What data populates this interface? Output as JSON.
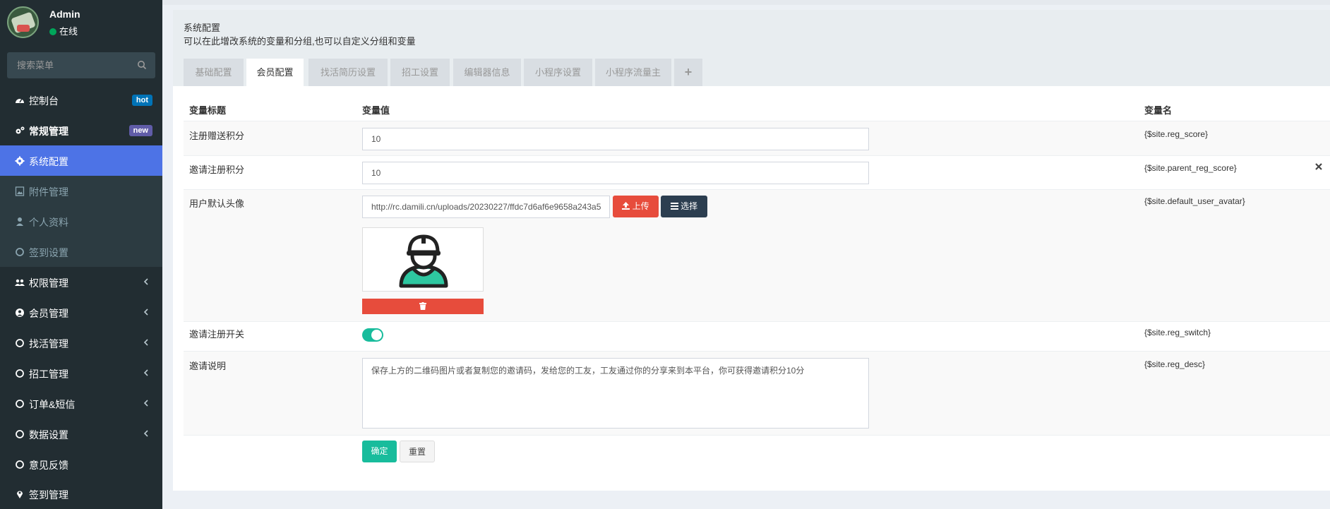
{
  "user": {
    "name": "Admin",
    "status": "在线"
  },
  "search": {
    "placeholder": "搜索菜单"
  },
  "sidebar": {
    "items": [
      {
        "label": "控制台",
        "badge": "hot",
        "badge_color": "#0073b7"
      },
      {
        "label": "常规管理",
        "badge": "new",
        "badge_color": "#605ca8"
      },
      {
        "label": "系统配置"
      },
      {
        "label": "附件管理"
      },
      {
        "label": "个人资料"
      },
      {
        "label": "签到设置"
      },
      {
        "label": "权限管理"
      },
      {
        "label": "会员管理"
      },
      {
        "label": "找活管理"
      },
      {
        "label": "招工管理"
      },
      {
        "label": "订单&短信"
      },
      {
        "label": "数据设置"
      },
      {
        "label": "意见反馈"
      },
      {
        "label": "签到管理"
      }
    ]
  },
  "page": {
    "title": "系统配置",
    "description": "可以在此增改系统的变量和分组,也可以自定义分组和变量"
  },
  "tabs": [
    {
      "label": "基础配置"
    },
    {
      "label": "会员配置"
    },
    {
      "label": "找活简历设置"
    },
    {
      "label": "招工设置"
    },
    {
      "label": "编辑器信息"
    },
    {
      "label": "小程序设置"
    },
    {
      "label": "小程序流量主"
    },
    {
      "label": "+"
    }
  ],
  "table": {
    "headers": {
      "title": "变量标题",
      "value": "变量值",
      "name": "变量名"
    },
    "rows": [
      {
        "title": "注册赠送积分",
        "value": "10",
        "var": "{$site.reg_score}"
      },
      {
        "title": "邀请注册积分",
        "value": "10",
        "var": "{$site.parent_reg_score}"
      },
      {
        "title": "用户默认头像",
        "value": "http://rc.damili.cn/uploads/20230227/ffdc7d6af6e9658a243a5",
        "var": "{$site.default_user_avatar}"
      },
      {
        "title": "邀请注册开关",
        "value": "on",
        "var": "{$site.reg_switch}"
      },
      {
        "title": "邀请说明",
        "value": "保存上方的二维码图片或者复制您的邀请码，发给您的工友，工友通过你的分享来到本平台，你可获得邀请积分10分",
        "var": "{$site.reg_desc}"
      }
    ]
  },
  "buttons": {
    "upload": "上传",
    "choose": "选择",
    "submit": "确定",
    "reset": "重置"
  },
  "colors": {
    "accent": "#4d73e6",
    "success": "#18bc9c",
    "danger": "#e74c3c",
    "dark": "#2c3e50"
  }
}
